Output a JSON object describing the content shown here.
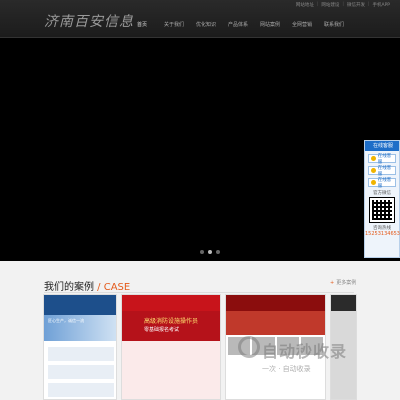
{
  "header": {
    "logo": "济南百安信息",
    "toplinks": [
      "网站地址",
      "网站建设",
      "微信开发",
      "手机APP"
    ],
    "nav": [
      "首页",
      "关于我们",
      "优化知识",
      "产品体系",
      "网站案例",
      "全网营销",
      "联系我们"
    ]
  },
  "hero": {
    "slides": 3,
    "active": 1
  },
  "cases": {
    "title_cn": "我们的案例",
    "title_sep": " / ",
    "title_en": "CASE",
    "more": "更多案例",
    "thumb1_text": "匠心生产，诚信一流",
    "thumb2_line1": "高级消防设施操作员",
    "thumb2_line2": "零基础报名考试"
  },
  "watermark": {
    "text": "自动秒收录",
    "sub": "一次 · 自动收录"
  },
  "service": {
    "title": "在线客服",
    "qq1": "在线客服",
    "qq2": "在线客服",
    "qq3": "在线客服",
    "wechat_label": "官方微信",
    "tel_label": "咨询热线",
    "tel": "15253134653"
  }
}
